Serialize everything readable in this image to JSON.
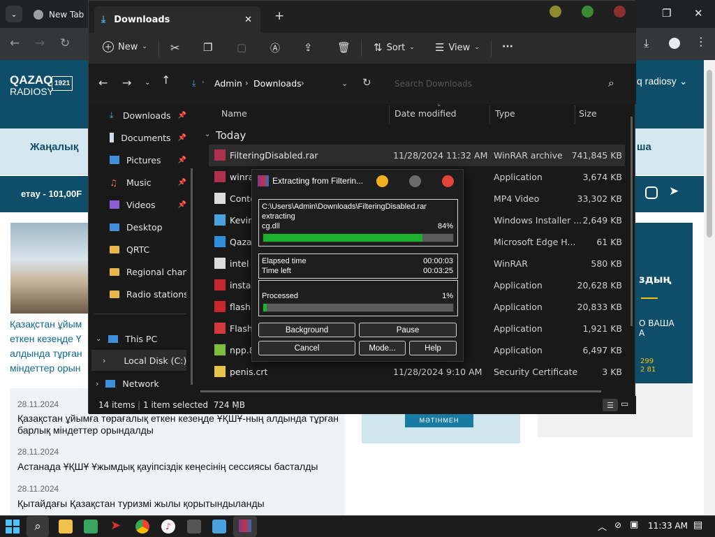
{
  "browser": {
    "tab_title": "New Tab",
    "window_controls": [
      "—",
      "❐",
      "✕"
    ]
  },
  "website": {
    "logo_line1": "QAZAQ",
    "logo_line2": "RADIOSY",
    "logo_year": "1921",
    "header_right": "q radiosy",
    "menu_left": "Жаңалық",
    "menu_right": "ша",
    "ticker": "етау - 101,00F",
    "news_headline_lines": [
      "Қазақстан ұйым",
      "еткен кезеңде Ү",
      "алдында тұрған",
      "міндеттер орын"
    ],
    "news_list": [
      {
        "date": "28.11.2024",
        "title": "Қазақстан ұйымға төрағалық еткен кезеңде ҰҚШҰ-ның алдында тұрған барлық міндеттер орындалды"
      },
      {
        "date": "28.11.2024",
        "title": "Астанада ҰҚШҰ Ұжымдық қауіпсіздік кеңесінің сессиясы басталды"
      },
      {
        "date": "28.11.2024",
        "title": "Қытайдағы Қазақстан туризмі жылы қорытындыланды"
      }
    ],
    "ad_button": "МӘТІНМЕН",
    "ad2_word": "здың",
    "ad2_line1": "О ВАША",
    "ad2_line2": "А",
    "ad2_phone1": "299",
    "ad2_phone2": "2 81"
  },
  "explorer": {
    "tab_title": "Downloads",
    "commands": {
      "new": "New",
      "sort": "Sort",
      "view": "View",
      "more": "···"
    },
    "breadcrumb": [
      "Admin",
      "Downloads"
    ],
    "search_placeholder": "Search Downloads",
    "nav_items": [
      {
        "label": "Downloads",
        "pinned": true
      },
      {
        "label": "Documents",
        "pinned": true
      },
      {
        "label": "Pictures",
        "pinned": true
      },
      {
        "label": "Music",
        "pinned": true
      },
      {
        "label": "Videos",
        "pinned": true
      },
      {
        "label": "Desktop",
        "pinned": false
      },
      {
        "label": "QRTC",
        "pinned": false
      },
      {
        "label": "Regional channe",
        "pinned": false
      },
      {
        "label": "Radio stations",
        "pinned": false
      }
    ],
    "nav_this_pc": "This PC",
    "nav_local_disk": "Local Disk (C:)",
    "nav_network": "Network",
    "columns": {
      "name": "Name",
      "date": "Date modified",
      "type": "Type",
      "size": "Size"
    },
    "group": "Today",
    "files": [
      {
        "name": "FilteringDisabled.rar",
        "date": "11/28/2024 11:32 AM",
        "type": "WinRAR archive",
        "size": "741,845 KB",
        "icon": "winrar-archive-icon",
        "color": "#b03050"
      },
      {
        "name": "winrar-",
        "date": "M",
        "type": "Application",
        "size": "3,674 KB",
        "icon": "winrar-installer-icon",
        "color": "#b03050"
      },
      {
        "name": "Conter",
        "date": "M",
        "type": "MP4 Video",
        "size": "33,302 KB",
        "icon": "video-file-icon",
        "color": "#dddddd"
      },
      {
        "name": "KevinM",
        "date": "M",
        "type": "Windows Installer ...",
        "size": "2,649 KB",
        "icon": "installer-icon",
        "color": "#4aa3df"
      },
      {
        "name": "Qazaqs",
        "date": "M",
        "type": "Microsoft Edge H...",
        "size": "61 KB",
        "icon": "edge-html-icon",
        "color": "#2f8fd8"
      },
      {
        "name": "intel e1",
        "date": "M",
        "type": "WinRAR",
        "size": "580 KB",
        "icon": "document-file-icon",
        "color": "#dddddd"
      },
      {
        "name": "install_",
        "date": "M",
        "type": "Application",
        "size": "20,628 KB",
        "icon": "flash-installer-icon",
        "color": "#c8262d"
      },
      {
        "name": "flashpl",
        "date": "M",
        "type": "Application",
        "size": "20,833 KB",
        "icon": "flash-player-icon",
        "color": "#c8262d"
      },
      {
        "name": "Flashpo",
        "date": "M",
        "type": "Application",
        "size": "1,921 KB",
        "icon": "flashpoint-icon",
        "color": "#d33b3b"
      },
      {
        "name": "npp.8.7",
        "date": "M",
        "type": "Application",
        "size": "6,497 KB",
        "icon": "notepad-plus-icon",
        "color": "#7cbf3c"
      },
      {
        "name": "penis.crt",
        "date": "11/28/2024 9:10 AM",
        "type": "Security Certificate",
        "size": "3 KB",
        "icon": "certificate-icon",
        "color": "#e6c34a"
      }
    ],
    "status": {
      "count": "14 items",
      "selected": "1 item selected  724 MB"
    }
  },
  "winrar": {
    "title": "Extracting from Filterin...",
    "path": "C:\\Users\\Admin\\Downloads\\FilteringDisabled.rar",
    "action": "extracting",
    "current_file": "cg.dll",
    "file_percent_label": "84%",
    "file_progress": 0.84,
    "elapsed_label": "Elapsed time",
    "elapsed": "00:00:03",
    "timeleft_label": "Time left",
    "timeleft": "00:03:25",
    "processed_label": "Processed",
    "processed_percent_label": "1%",
    "processed_progress": 0.01,
    "buttons": {
      "background": "Background",
      "pause": "Pause",
      "cancel": "Cancel",
      "mode": "Mode...",
      "help": "Help"
    },
    "dot_colors": [
      "#f0b020",
      "#6b6b6b",
      "#e0443a"
    ],
    "progress_color": "#1bb12d"
  },
  "taskbar": {
    "time": "11:33 AM"
  }
}
